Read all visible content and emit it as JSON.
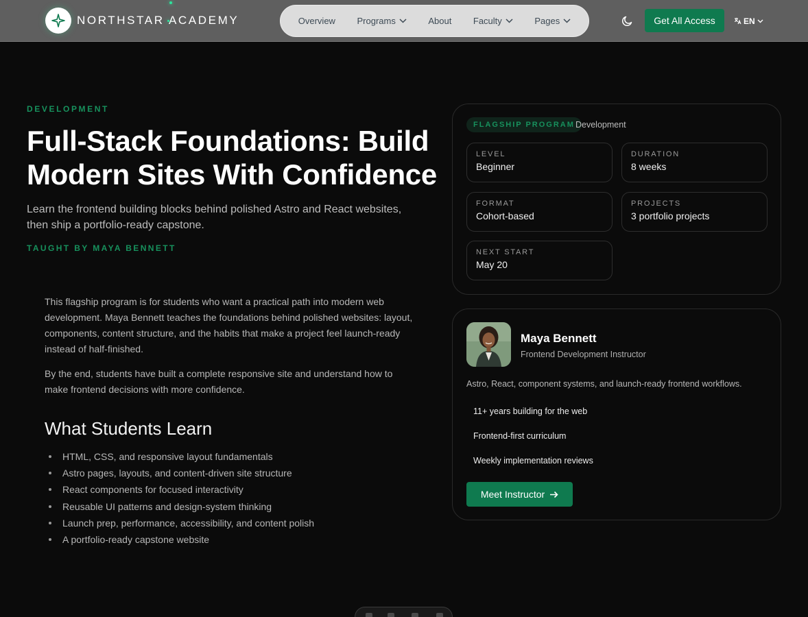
{
  "brand": {
    "name": "NORTHSTAR ACADEMY",
    "logo_icon": "sparkle-star-icon"
  },
  "nav": {
    "items": [
      {
        "label": "Overview",
        "dropdown": false
      },
      {
        "label": "Programs",
        "dropdown": true
      },
      {
        "label": "About",
        "dropdown": false
      },
      {
        "label": "Faculty",
        "dropdown": true
      },
      {
        "label": "Pages",
        "dropdown": true
      }
    ]
  },
  "header": {
    "theme_icon": "moon-icon",
    "cta_label": "Get All Access",
    "language": "EN",
    "language_icon": "translate-icon"
  },
  "hero": {
    "eyebrow": "DEVELOPMENT",
    "title": "Full-Stack Foundations: Build Modern Sites With Confidence",
    "subtitle": "Learn the frontend building blocks behind polished Astro and React websites, then ship a portfolio-ready capstone.",
    "taught_by": "TAUGHT BY MAYA BENNETT"
  },
  "body": {
    "paragraphs": [
      "This flagship program is for students who want a practical path into modern web development. Maya Bennett teaches the foundations behind polished websites: layout, components, content structure, and the habits that make a project feel launch-ready instead of half-finished.",
      "By the end, students have built a complete responsive site and understand how to make frontend decisions with more confidence."
    ]
  },
  "learn": {
    "title": "What Students Learn",
    "items": [
      "HTML, CSS, and responsive layout fundamentals",
      "Astro pages, layouts, and content-driven site structure",
      "React components for focused interactivity",
      "Reusable UI patterns and design-system thinking",
      "Launch prep, performance, accessibility, and content polish",
      "A portfolio-ready capstone website"
    ]
  },
  "program": {
    "badge": "FLAGSHIP PROGRAM",
    "category": "Development",
    "stats": [
      {
        "label": "LEVEL",
        "value": "Beginner"
      },
      {
        "label": "DURATION",
        "value": "8 weeks"
      },
      {
        "label": "FORMAT",
        "value": "Cohort-based"
      },
      {
        "label": "PROJECTS",
        "value": "3 portfolio projects"
      },
      {
        "label": "NEXT START",
        "value": "May 20"
      }
    ]
  },
  "instructor": {
    "name": "Maya Bennett",
    "role": "Frontend Development Instructor",
    "bio": "Astro, React, component systems, and launch-ready frontend workflows.",
    "highlights": [
      "11+ years building for the web",
      "Frontend-first curriculum",
      "Weekly implementation reviews"
    ],
    "button_label": "Meet Instructor",
    "button_icon": "arrow-right-icon"
  },
  "colors": {
    "accent": "#0f7a4f",
    "accent_text": "#17915d",
    "background": "#0b0b0b",
    "header_bg": "#5f5f5f",
    "nav_pill_bg": "#dcdcdc"
  }
}
